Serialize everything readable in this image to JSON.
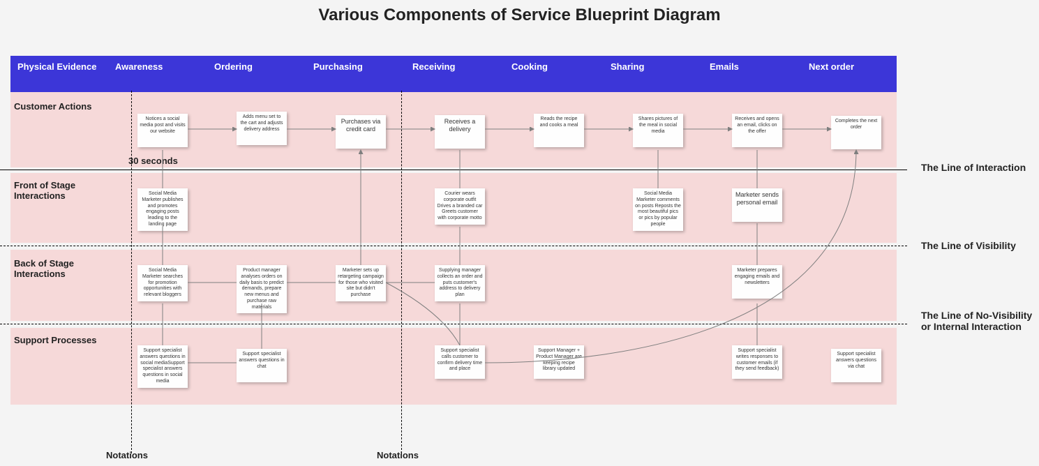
{
  "title": "Various Components of Service Blueprint Diagram",
  "headers": [
    "Physical Evidence",
    "Awareness",
    "Ordering",
    "Purchasing",
    "Receiving",
    "Cooking",
    "Sharing",
    "Emails",
    "Next order"
  ],
  "row_labels": {
    "customer": "Customer Actions",
    "front": "Front of Stage Interactions",
    "back": "Back of Stage Interactions",
    "support": "Support Processes"
  },
  "time_label": "30 seconds",
  "side_labels": {
    "interaction": "The Line of Interaction",
    "visibility": "The Line of Visibility",
    "novis": "The Line of No-Visibility or Internal Interaction"
  },
  "notations": "Notations",
  "notes": {
    "c_awareness": "Notices a social media post and visits our website",
    "c_ordering": "Adds menu set to the cart and adjusts delivery address",
    "c_purchasing": "Purchases via credit card",
    "c_receiving": "Receives a delivery",
    "c_cooking": "Reads the recipe and cooks a meal",
    "c_sharing": "Shares pictures of the meal in social media",
    "c_emails": "Receives and opens an email, clicks on the offer",
    "c_next": "Completes the next order",
    "f_awareness": "Social Media Marketer publishes and promotes engaging posts leading to the landing page",
    "f_receiving": "Courier wears corporate outfit Drives a branded car Greets customer with corporate motto",
    "f_sharing": "Social Media Marketer comments on posts Reposts the most beautiful pics or pics by popular people",
    "f_emails": "Marketer sends personal email",
    "b_awareness": "Social Media Marketer searches for promotion opportunities with relevant bloggers",
    "b_ordering": "Product manager analyses orders on daily basis to predict demands, prepare new menus and purchase raw materials",
    "b_purchasing": "Marketer sets up retargeting campaign for those who visited site but didn't purchase",
    "b_receiving": "Supplying manager collects an order and puts customer's address to delivery plan",
    "b_emails": "Marketer prepares engaging emails and newsletters",
    "s_awareness": "Support specialist answers questions in social mediaSupport specialist answers questions in social media",
    "s_ordering": "Support specialist answers questions in chat",
    "s_receiving": "Support specialist calls customer to confirm delivery time and place",
    "s_cooking": "Support Manager + Product Manager are keeping recipe library updated",
    "s_emails": "Support specialist writes responses to customer emails (if they send feedback)",
    "s_next": "Support specialist answers questions via chat"
  }
}
